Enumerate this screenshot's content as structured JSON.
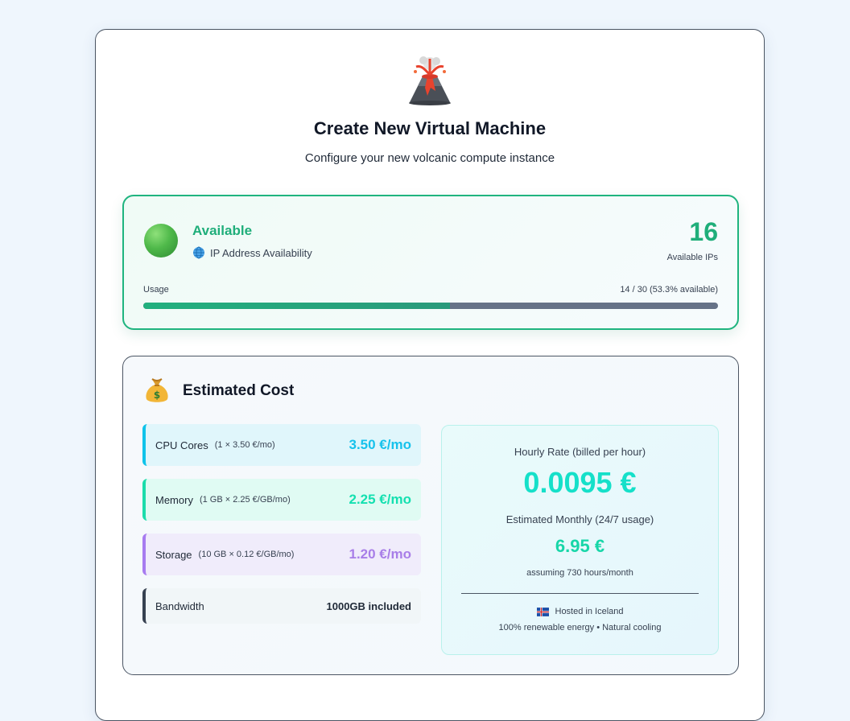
{
  "header": {
    "icon": "volcano-icon",
    "title": "Create New Virtual Machine",
    "subtitle": "Configure your new volcanic compute instance"
  },
  "ip_availability": {
    "status_icon": "green-circle-icon",
    "status": "Available",
    "caption_icon": "globe-icon",
    "caption": "IP Address Availability",
    "available_count": "16",
    "available_label": "Available IPs",
    "usage_label": "Usage",
    "usage_text": "14 / 30 (53.3% available)",
    "used_fraction": 0.533,
    "colors": {
      "accent": "#1fae7a",
      "track": "#667287"
    }
  },
  "cost": {
    "icon": "money-bag-icon",
    "title": "Estimated Cost",
    "items": [
      {
        "name": "CPU Cores",
        "detail": "(1 × 3.50 €/mo)",
        "price": "3.50 €/mo",
        "color": "#16c2ec"
      },
      {
        "name": "Memory",
        "detail": "(1 GB × 2.25 €/GB/mo)",
        "price": "2.25 €/mo",
        "color": "#14e0b0"
      },
      {
        "name": "Storage",
        "detail": "(10 GB × 0.12 €/GB/mo)",
        "price": "1.20 €/mo",
        "color": "#a87ee8"
      },
      {
        "name": "Bandwidth",
        "detail": "",
        "price": "1000GB included",
        "color": "#374151"
      }
    ],
    "hourly_label": "Hourly Rate (billed per hour)",
    "hourly_value": "0.0095 €",
    "monthly_label": "Estimated Monthly (24/7 usage)",
    "monthly_value": "6.95 €",
    "monthly_note": "assuming 730 hours/month",
    "hosted_icon": "iceland-flag-icon",
    "hosted": "Hosted in Iceland",
    "energy": "100% renewable energy • Natural cooling"
  }
}
